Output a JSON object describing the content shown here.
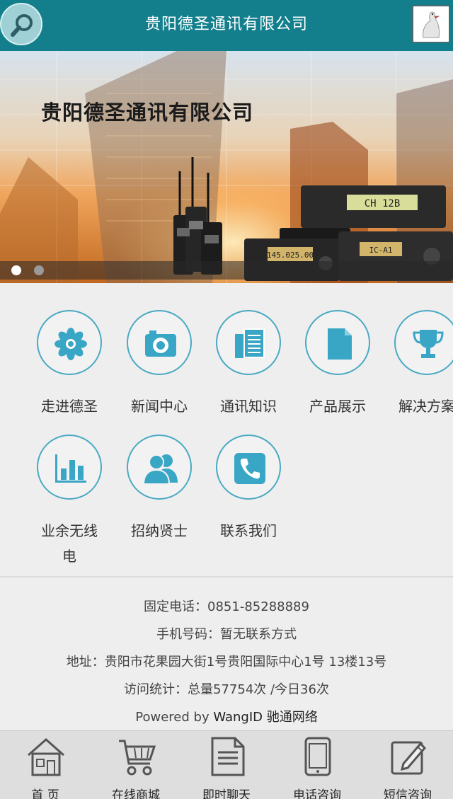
{
  "header": {
    "title": "贵阳德圣通讯有限公司",
    "search_icon": "search-icon",
    "logo_icon": "bird-logo-icon"
  },
  "banner": {
    "title": "贵阳德圣通讯有限公司",
    "radio_display_1": "CH 12B",
    "radio_display_2": "145.025.00",
    "radio_display_3": "IC-A1"
  },
  "menu": {
    "items": [
      {
        "label": "走进德圣",
        "icon": "flower-icon"
      },
      {
        "label": "新闻中心",
        "icon": "camera-icon"
      },
      {
        "label": "通讯知识",
        "icon": "documents-icon"
      },
      {
        "label": "产品展示",
        "icon": "file-icon"
      },
      {
        "label": "解决方案",
        "icon": "trophy-icon"
      },
      {
        "label": "业余无线电",
        "icon": "bar-chart-icon"
      },
      {
        "label": "招纳贤士",
        "icon": "people-icon"
      },
      {
        "label": "联系我们",
        "icon": "phone-icon"
      }
    ]
  },
  "info": {
    "phone": "固定电话：0851-85288889",
    "mobile": "手机号码：暂无联系方式",
    "address": "地址：贵阳市花果园大街1号贵阳国际中心1号 13楼13号",
    "stats": "访问统计：总量57754次 /今日36次",
    "powered_prefix": "Powered by",
    "powered_brand": "WangID 驰通网络"
  },
  "bottom_nav": {
    "items": [
      {
        "label": "首 页",
        "icon": "home-icon"
      },
      {
        "label": "在线商城",
        "icon": "cart-icon"
      },
      {
        "label": "即时聊天",
        "icon": "chat-doc-icon"
      },
      {
        "label": "电话咨询",
        "icon": "mobile-phone-icon"
      },
      {
        "label": "短信咨询",
        "icon": "edit-message-icon"
      }
    ]
  },
  "colors": {
    "header_bg": "#137f8c",
    "icon_blue": "#3aa6c6",
    "circle_border": "#49a9c3"
  }
}
